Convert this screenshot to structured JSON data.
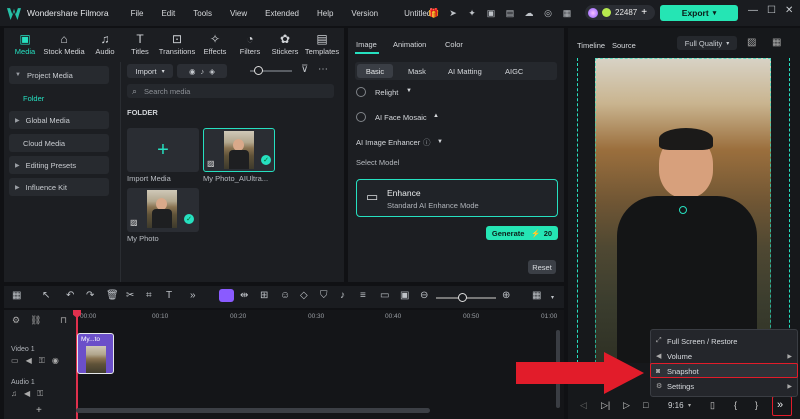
{
  "app": {
    "title": "Wondershare Filmora",
    "document": "Untitled"
  },
  "menu": [
    "File",
    "Edit",
    "Tools",
    "View",
    "Extended",
    "Help",
    "Version"
  ],
  "credits": {
    "count": "22487"
  },
  "export_label": "Export",
  "media_tabs": [
    {
      "label": "Media",
      "icon": "media-icon"
    },
    {
      "label": "Stock Media",
      "icon": "stock-media-icon"
    },
    {
      "label": "Audio",
      "icon": "audio-icon"
    },
    {
      "label": "Titles",
      "icon": "titles-icon"
    },
    {
      "label": "Transitions",
      "icon": "transitions-icon"
    },
    {
      "label": "Effects",
      "icon": "effects-icon"
    },
    {
      "label": "Filters",
      "icon": "filters-icon"
    },
    {
      "label": "Stickers",
      "icon": "stickers-icon"
    },
    {
      "label": "Templates",
      "icon": "templates-icon"
    }
  ],
  "sidebar": {
    "items": [
      "Project Media",
      "Folder",
      "Global Media",
      "Cloud Media",
      "Editing Presets",
      "Influence Kit"
    ]
  },
  "media_toolbar": {
    "import": "Import",
    "search_placeholder": "Search media",
    "folder_label": "FOLDER"
  },
  "media_items": [
    {
      "label": "Import Media"
    },
    {
      "label": "My Photo_AIUltra..."
    },
    {
      "label": "My Photo"
    }
  ],
  "props": {
    "tabs": [
      "Image",
      "Animation",
      "Color"
    ],
    "subtabs": [
      "Basic",
      "Mask",
      "AI Matting",
      "AIGC"
    ],
    "relight": "Relight",
    "face_mosaic": "AI Face Mosaic",
    "enhancer": "AI Image Enhancer",
    "select_model": "Select Model",
    "model_name": "Enhance",
    "model_desc": "Standard AI Enhance Mode",
    "generate": "Generate",
    "generate_cost": "20",
    "reset": "Reset"
  },
  "preview": {
    "tabs": [
      "Timeline",
      "Source"
    ],
    "quality": "Full Quality",
    "ratio": "9:16"
  },
  "timeline": {
    "ruler": [
      "00:00",
      "00:10",
      "00:20",
      "00:30",
      "00:40",
      "00:50",
      "01:00"
    ],
    "tracks": [
      "Video 1",
      "Audio 1"
    ],
    "clip": "My...to"
  },
  "context_menu": [
    "Full Screen / Restore",
    "Volume",
    "Snapshot",
    "Settings"
  ],
  "colors": {
    "accent": "#26e0c0",
    "highlight": "#e21c2a"
  }
}
